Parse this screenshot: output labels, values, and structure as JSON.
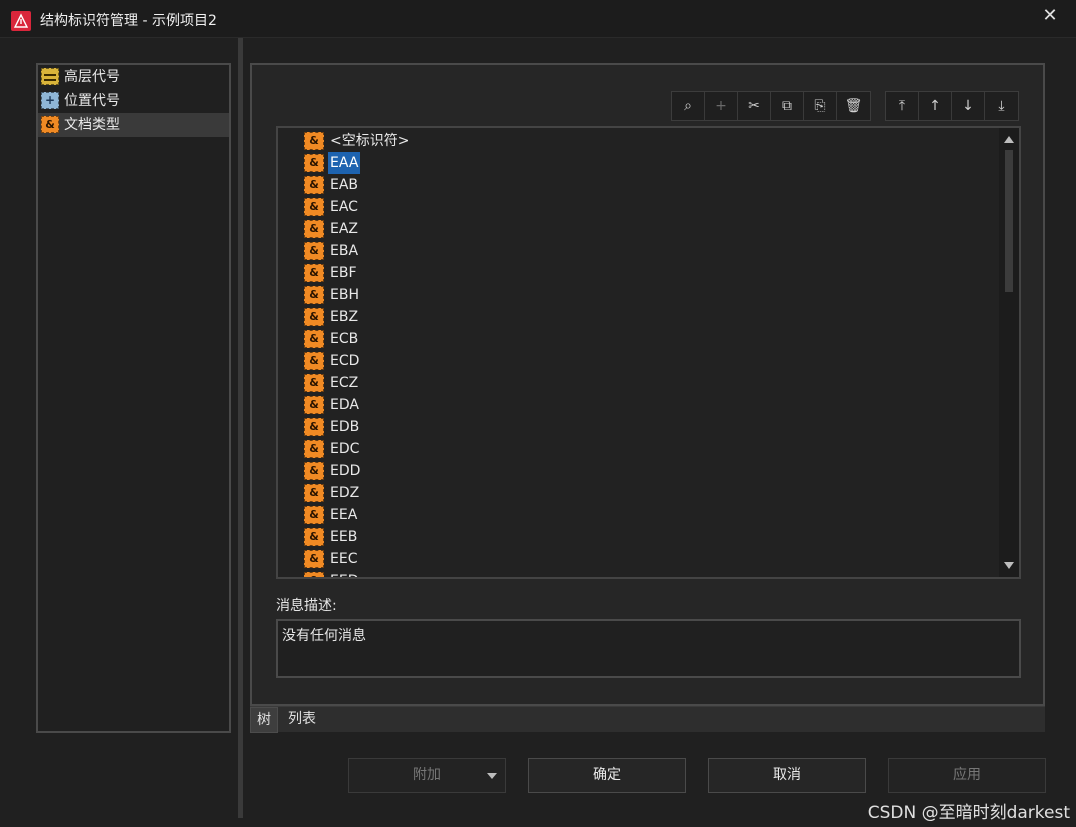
{
  "window": {
    "title": "结构标识符管理 - 示例项目2",
    "close_symbol": "✕"
  },
  "left_nav": {
    "items": [
      {
        "label": "高层代号",
        "icon": "high-level-code-icon"
      },
      {
        "label": "位置代号",
        "icon": "location-code-icon",
        "glyph": "+"
      },
      {
        "label": "文档类型",
        "icon": "document-type-icon",
        "glyph": "&",
        "selected": true
      }
    ]
  },
  "toolbar": {
    "group1": [
      {
        "name": "search-icon",
        "glyph": "⌕",
        "enabled": true
      },
      {
        "name": "add-icon",
        "glyph": "+",
        "enabled": false
      },
      {
        "name": "cut-icon",
        "glyph": "✂",
        "enabled": true
      },
      {
        "name": "copy-icon",
        "glyph": "⧉",
        "enabled": true
      },
      {
        "name": "paste-icon",
        "glyph": "⎘",
        "enabled": true
      },
      {
        "name": "delete-icon",
        "glyph": "🗑",
        "enabled": true
      }
    ],
    "group2": [
      {
        "name": "move-top-icon",
        "glyph": "⤒",
        "enabled": true
      },
      {
        "name": "move-up-icon",
        "glyph": "↑",
        "enabled": true
      },
      {
        "name": "move-down-icon",
        "glyph": "↓",
        "enabled": true
      },
      {
        "name": "move-bottom-icon",
        "glyph": "⤓",
        "enabled": true
      }
    ]
  },
  "tree": {
    "icon_glyph": "&",
    "items": [
      "<空标识符>",
      "EAA",
      "EAB",
      "EAC",
      "EAZ",
      "EBA",
      "EBF",
      "EBH",
      "EBZ",
      "ECB",
      "ECD",
      "ECZ",
      "EDA",
      "EDB",
      "EDC",
      "EDD",
      "EDZ",
      "EEA",
      "EEB",
      "EEC",
      "EED"
    ],
    "selected_index": 1
  },
  "message": {
    "label": "消息描述:",
    "text": "没有任何消息"
  },
  "tabs": [
    {
      "label": "树",
      "active": true
    },
    {
      "label": "列表",
      "active": false
    }
  ],
  "buttons": {
    "append": "附加",
    "ok": "确定",
    "cancel": "取消",
    "apply": "应用"
  },
  "watermark": "CSDN @至暗时刻darkest",
  "colors": {
    "selection": "#1d63b0",
    "doc_type_icon": "#f08a24",
    "high_level_icon": "#d9b43a",
    "location_icon": "#8fb6d6",
    "app_icon": "#d9263b"
  }
}
